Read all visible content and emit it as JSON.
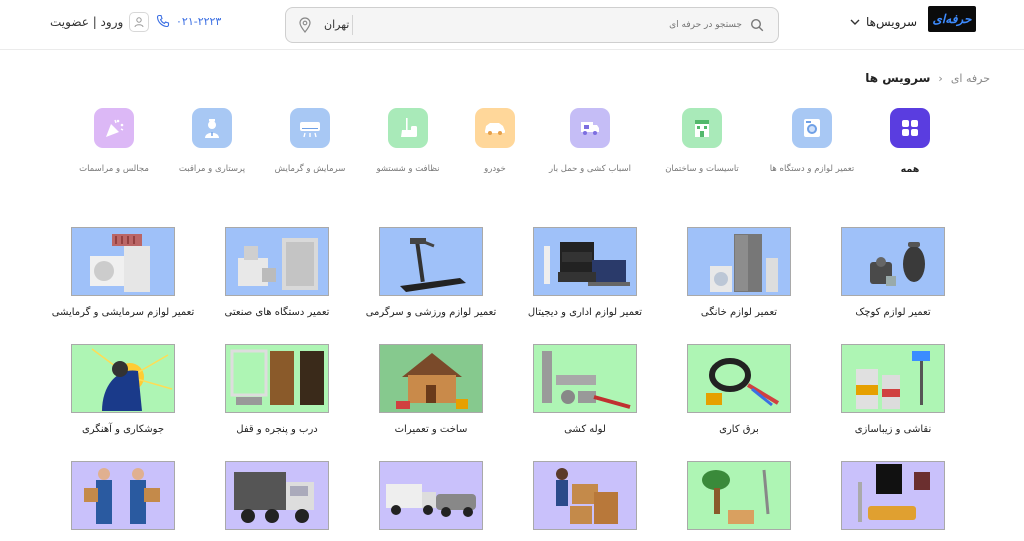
{
  "header": {
    "logo_text": "حرفه‌ای",
    "services_label": "سرویس‌ها",
    "search_placeholder": "جستجو در حرفه ای",
    "city": "تهران",
    "phone": "۰۲۱-۲۲۲۳",
    "login": "ورود | عضویت"
  },
  "breadcrumb": {
    "home": "حرفه ای",
    "current": "سرویس ها"
  },
  "categories": [
    {
      "label": "همه",
      "color": "#5a3de0",
      "icon": "grid-icon"
    },
    {
      "label": "تعمیر لوازم و دستگاه ها",
      "color": "#a8c8f4",
      "icon": "washing-machine-icon"
    },
    {
      "label": "تاسیسات و ساختمان",
      "color": "#a9eab9",
      "icon": "building-icon"
    },
    {
      "label": "اسباب کشی و حمل بار",
      "color": "#c5bdf6",
      "icon": "truck-icon"
    },
    {
      "label": "خودرو",
      "color": "#ffd79a",
      "icon": "car-icon"
    },
    {
      "label": "نظافت و شستشو",
      "color": "#a9eab9",
      "icon": "cleaning-icon"
    },
    {
      "label": "سرمایش و گرمایش",
      "color": "#a8c8f4",
      "icon": "air-conditioner-icon"
    },
    {
      "label": "پرستاری و مراقبت",
      "color": "#a8c8f4",
      "icon": "nurse-icon"
    },
    {
      "label": "مجالس و مراسمات",
      "color": "#dcb8f6",
      "icon": "party-icon"
    }
  ],
  "services": [
    {
      "title": "تعمیر لوازم کوچک",
      "bg": "#9fc1f9"
    },
    {
      "title": "تعمیر لوازم خانگی",
      "bg": "#9fc1f9"
    },
    {
      "title": "تعمیر لوازم اداری و دیجیتال",
      "bg": "#9fc1f9"
    },
    {
      "title": "تعمیر لوازم ورزشی و سرگرمی",
      "bg": "#9fc1f9"
    },
    {
      "title": "تعمیر دستگاه های صنعتی",
      "bg": "#9fc1f9"
    },
    {
      "title": "تعمیر لوازم سرمایشی و گرمایشی",
      "bg": "#9fc1f9"
    },
    {
      "title": "نقاشی و زیباسازی",
      "bg": "#aef5b4"
    },
    {
      "title": "برق کاری",
      "bg": "#aef5b4"
    },
    {
      "title": "لوله کشی",
      "bg": "#aef5b4"
    },
    {
      "title": "ساخت و تعمیرات",
      "bg": "#86c98e"
    },
    {
      "title": "درب و پنجره و قفل",
      "bg": "#aef5b4"
    },
    {
      "title": "جوشکاری و آهنگری",
      "bg": "#aef5b4"
    },
    {
      "title": "",
      "bg": "#c9c1fb"
    },
    {
      "title": "",
      "bg": "#aef5b4"
    },
    {
      "title": "",
      "bg": "#c9c1fb"
    },
    {
      "title": "",
      "bg": "#c9c1fb"
    },
    {
      "title": "",
      "bg": "#c9c1fb"
    },
    {
      "title": "",
      "bg": "#c9c1fb"
    }
  ]
}
